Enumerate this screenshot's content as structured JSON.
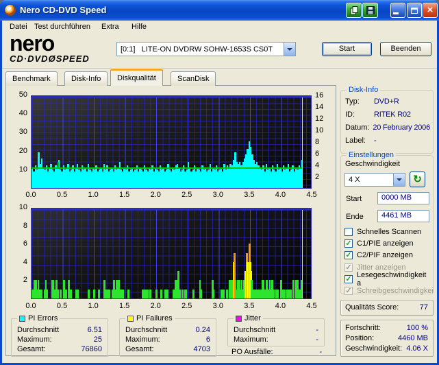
{
  "window": {
    "title": "Nero CD-DVD Speed"
  },
  "menu": {
    "items": [
      "Datei",
      "Test durchführen",
      "Extra",
      "Hilfe"
    ]
  },
  "header": {
    "logo_top": "nero",
    "logo_bottom_left": "CD·DVD",
    "logo_glyph": "Ø",
    "logo_bottom_right": "SPEED",
    "drive_selected": "[0:1]   LITE-ON DVDRW SOHW-1653S CS0T",
    "start_label": "Start",
    "quit_label": "Beenden"
  },
  "tabs": [
    {
      "label": "Benchmark",
      "active": false
    },
    {
      "label": "Disk-Info",
      "active": false
    },
    {
      "label": "Diskqualität",
      "active": true
    },
    {
      "label": "ScanDisk",
      "active": false
    }
  ],
  "disk_info": {
    "title": "Disk-Info",
    "rows": [
      {
        "label": "Typ:",
        "value": "DVD+R"
      },
      {
        "label": "ID:",
        "value": "RITEK R02"
      },
      {
        "label": "Datum:",
        "value": "20 February 2006"
      },
      {
        "label": "Label:",
        "value": "-"
      }
    ]
  },
  "settings": {
    "title": "Einstellungen",
    "speed_label": "Geschwindigkeit",
    "speed_value": "4 X",
    "start_label": "Start",
    "start_value": "0000 MB",
    "end_label": "Ende",
    "end_value": "4461 MB",
    "checkboxes": [
      {
        "label": "Schnelles Scannen",
        "checked": false,
        "enabled": true
      },
      {
        "label": "C1/PIE anzeigen",
        "checked": true,
        "enabled": true
      },
      {
        "label": "C2/PIF anzeigen",
        "checked": true,
        "enabled": true
      },
      {
        "label": "Jitter anzeigen",
        "checked": true,
        "enabled": false
      },
      {
        "label": "Lesegeschwindigkeit a",
        "checked": true,
        "enabled": true
      },
      {
        "label": "Schreibgeschwindigkei",
        "checked": true,
        "enabled": false
      }
    ]
  },
  "quality": {
    "label": "Qualitäts Score:",
    "value": "77"
  },
  "progress": {
    "rows": [
      {
        "label": "Fortschritt:",
        "value": "100 %"
      },
      {
        "label": "Position:",
        "value": "4460 MB"
      },
      {
        "label": "Geschwindigkeit:",
        "value": "4.06 X"
      }
    ]
  },
  "stats": [
    {
      "title": "PI Errors",
      "color": "#00ffff",
      "rows": [
        {
          "label": "Durchschnitt",
          "value": "6.51"
        },
        {
          "label": "Maximum:",
          "value": "25"
        },
        {
          "label": "Gesamt:",
          "value": "76860"
        }
      ]
    },
    {
      "title": "PI Failures",
      "color": "#ffff00",
      "rows": [
        {
          "label": "Durchschnitt",
          "value": "0.24"
        },
        {
          "label": "Maximum:",
          "value": "6"
        },
        {
          "label": "Gesamt:",
          "value": "4703"
        }
      ]
    },
    {
      "title": "Jitter",
      "color": "#ff00ff",
      "rows": [
        {
          "label": "Durchschnitt",
          "value": "-"
        },
        {
          "label": "Maximum:",
          "value": "-"
        }
      ]
    }
  ],
  "po": {
    "label": "PO Ausfälle:",
    "value": "-"
  },
  "chart_data": [
    {
      "type": "area",
      "title": "PI Errors",
      "series_color": "#00ffff",
      "x_start": 0,
      "x_step": 0.025,
      "xlim": [
        0,
        4.5
      ],
      "ylim": [
        0,
        50
      ],
      "y2lim": [
        0,
        16
      ],
      "x_ticks": [
        "0.0",
        "0.5",
        "1.0",
        "1.5",
        "2.0",
        "2.5",
        "3.0",
        "3.5",
        "4.0",
        "4.5"
      ],
      "y_ticks_left": [
        10,
        20,
        30,
        40,
        50
      ],
      "y_ticks_right": [
        2,
        4,
        6,
        8,
        10,
        12,
        14,
        16
      ],
      "grid": true,
      "read_speed_line": {
        "value": 12.5,
        "right_axis_value": 4,
        "color": "#00c800",
        "spike_x": 0.42,
        "spike_value": 15.5
      },
      "cursor_x": 4.33,
      "values": [
        11,
        9,
        12,
        10,
        19,
        13,
        16,
        11,
        10,
        12,
        9,
        11,
        13,
        10,
        9,
        12,
        11,
        15,
        10,
        9,
        12,
        10,
        11,
        13,
        9,
        10,
        12,
        9,
        11,
        13,
        10,
        9,
        12,
        10,
        11,
        9,
        13,
        10,
        9,
        11,
        10,
        12,
        9,
        10,
        11,
        9,
        13,
        10,
        12,
        9,
        10,
        11,
        9,
        12,
        10,
        11,
        14,
        10,
        9,
        11,
        10,
        12,
        9,
        10,
        11,
        9,
        10,
        12,
        9,
        11,
        10,
        9,
        12,
        10,
        9,
        11,
        10,
        12,
        9,
        11,
        10,
        9,
        12,
        10,
        11,
        9,
        10,
        13,
        10,
        9,
        11,
        10,
        12,
        13,
        11,
        9,
        10,
        12,
        9,
        10,
        14,
        11,
        9,
        10,
        12,
        9,
        11,
        10,
        9,
        12,
        10,
        11,
        9,
        10,
        13,
        9,
        11,
        10,
        12,
        9,
        10,
        11,
        9,
        13,
        10,
        12,
        11,
        13,
        12,
        15,
        19,
        14,
        13,
        14,
        12,
        14,
        16,
        18,
        21,
        25,
        22,
        18,
        15,
        13,
        14,
        12,
        11,
        10,
        12,
        9,
        13,
        10,
        11,
        9,
        12,
        10,
        9,
        13,
        10,
        11,
        9,
        12,
        10,
        11,
        13,
        9,
        10,
        12,
        9,
        11,
        10,
        12,
        11,
        15
      ]
    },
    {
      "type": "bar",
      "title": "PI Failures",
      "xlim": [
        0,
        4.5
      ],
      "ylim": [
        0,
        10
      ],
      "x_ticks": [
        "0.0",
        "0.5",
        "1.0",
        "1.5",
        "2.0",
        "2.5",
        "3.0",
        "3.5",
        "4.0",
        "4.5"
      ],
      "y_ticks_left": [
        2,
        4,
        6,
        8,
        10
      ],
      "grid": true,
      "colors": {
        "g": "#2ee42e",
        "y": "#ffff00",
        "o": "#ff9500"
      },
      "cursor_x": 4.33,
      "bars": [
        [
          0.02,
          1
        ],
        [
          0.05,
          2
        ],
        [
          0.07,
          2
        ],
        [
          0.09,
          1
        ],
        [
          0.11,
          2
        ],
        [
          0.13,
          1
        ],
        [
          0.16,
          1
        ],
        [
          0.21,
          1
        ],
        [
          0.23,
          2
        ],
        [
          0.25,
          1
        ],
        [
          0.33,
          2
        ],
        [
          0.35,
          2
        ],
        [
          0.37,
          1
        ],
        [
          0.4,
          2
        ],
        [
          0.42,
          1
        ],
        [
          0.47,
          1
        ],
        [
          0.52,
          2
        ],
        [
          0.55,
          1
        ],
        [
          0.6,
          2
        ],
        [
          0.63,
          1
        ],
        [
          0.72,
          1
        ],
        [
          0.74,
          1
        ],
        [
          0.92,
          1
        ],
        [
          1.0,
          1
        ],
        [
          1.08,
          1
        ],
        [
          1.17,
          2
        ],
        [
          1.19,
          1
        ],
        [
          1.22,
          1
        ],
        [
          1.25,
          1
        ],
        [
          1.3,
          1
        ],
        [
          1.32,
          2
        ],
        [
          1.34,
          1
        ],
        [
          1.36,
          2
        ],
        [
          1.38,
          2
        ],
        [
          1.4,
          2
        ],
        [
          1.42,
          1
        ],
        [
          1.45,
          1
        ],
        [
          1.47,
          1
        ],
        [
          1.55,
          1
        ],
        [
          1.78,
          1
        ],
        [
          1.82,
          1
        ],
        [
          1.84,
          1
        ],
        [
          1.86,
          1
        ],
        [
          1.9,
          1
        ],
        [
          2.0,
          1
        ],
        [
          2.08,
          1
        ],
        [
          2.15,
          1
        ],
        [
          2.18,
          1
        ],
        [
          2.28,
          1
        ],
        [
          2.31,
          2
        ],
        [
          2.33,
          2
        ],
        [
          2.35,
          3
        ],
        [
          2.36,
          2
        ],
        [
          2.38,
          1
        ],
        [
          2.42,
          1
        ],
        [
          2.46,
          1
        ],
        [
          2.48,
          1
        ],
        [
          2.6,
          1
        ],
        [
          2.7,
          2
        ],
        [
          2.72,
          1
        ],
        [
          2.9,
          2
        ],
        [
          2.92,
          1
        ],
        [
          3.05,
          1
        ],
        [
          3.08,
          1
        ],
        [
          3.13,
          1
        ],
        [
          3.18,
          2
        ],
        [
          3.2,
          2
        ],
        [
          3.22,
          2
        ],
        [
          3.24,
          4,
          "y"
        ],
        [
          3.25,
          5,
          "o"
        ],
        [
          3.27,
          2
        ],
        [
          3.29,
          1
        ],
        [
          3.31,
          2
        ],
        [
          3.33,
          2
        ],
        [
          3.35,
          1
        ],
        [
          3.37,
          2
        ],
        [
          3.39,
          1
        ],
        [
          3.41,
          2
        ],
        [
          3.43,
          3,
          "y"
        ],
        [
          3.44,
          3,
          "y"
        ],
        [
          3.45,
          5,
          "o"
        ],
        [
          3.46,
          4,
          "y"
        ],
        [
          3.47,
          4,
          "y"
        ],
        [
          3.48,
          3,
          "y"
        ],
        [
          3.49,
          4,
          "y"
        ],
        [
          3.5,
          6,
          "o"
        ],
        [
          3.51,
          4,
          "y"
        ],
        [
          3.52,
          3,
          "y"
        ],
        [
          3.53,
          2
        ],
        [
          3.54,
          1
        ],
        [
          3.55,
          1
        ],
        [
          3.56,
          1
        ],
        [
          3.57,
          1
        ],
        [
          3.58,
          1
        ],
        [
          3.59,
          1
        ],
        [
          3.6,
          1
        ],
        [
          3.61,
          1
        ],
        [
          3.62,
          1
        ],
        [
          3.63,
          1
        ],
        [
          3.64,
          1
        ],
        [
          3.65,
          1
        ],
        [
          3.67,
          1
        ],
        [
          3.7,
          2
        ],
        [
          3.72,
          2
        ],
        [
          3.74,
          1
        ],
        [
          3.77,
          2
        ],
        [
          3.8,
          1
        ],
        [
          3.82,
          2
        ],
        [
          3.84,
          1
        ],
        [
          3.86,
          2
        ],
        [
          3.88,
          1
        ],
        [
          3.92,
          1
        ],
        [
          3.95,
          1
        ],
        [
          4.0,
          2
        ],
        [
          4.03,
          1
        ],
        [
          4.06,
          1
        ],
        [
          4.1,
          1
        ],
        [
          4.12,
          1
        ],
        [
          4.15,
          1
        ],
        [
          4.2,
          2
        ],
        [
          4.24,
          2
        ],
        [
          4.27,
          2
        ],
        [
          4.3,
          1
        ],
        [
          4.33,
          2
        ]
      ]
    }
  ]
}
